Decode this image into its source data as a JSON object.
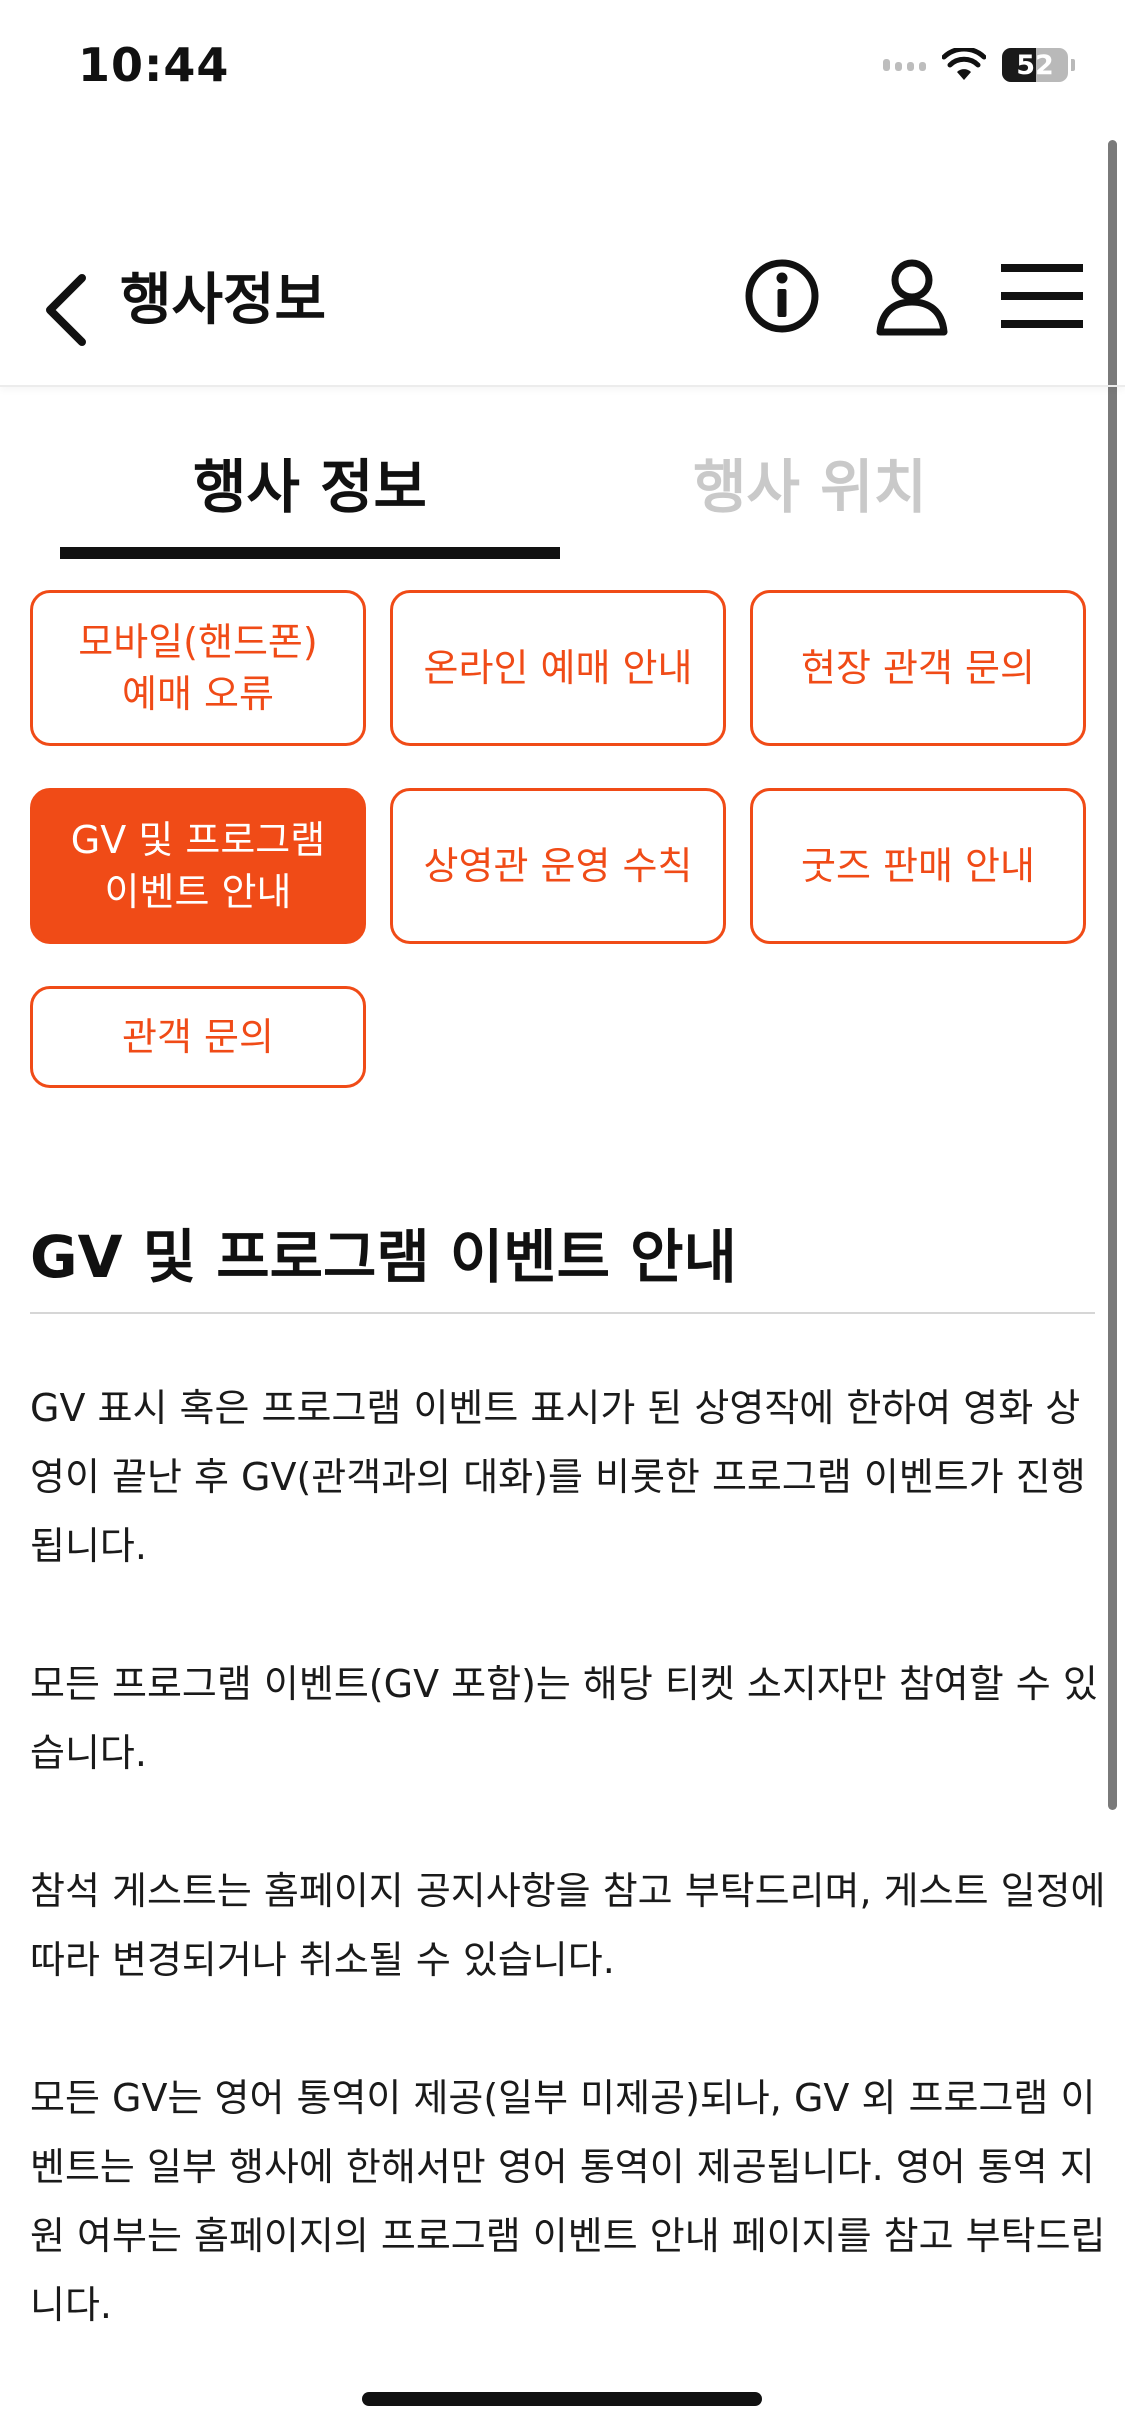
{
  "status_bar": {
    "time": "10:44",
    "battery": "52"
  },
  "header": {
    "title": "행사정보"
  },
  "tabs": [
    {
      "label": "행사 정보",
      "active": true
    },
    {
      "label": "행사 위치",
      "active": false
    }
  ],
  "categories": [
    {
      "label": "모바일(핸드폰)\n예매 오류",
      "active": false
    },
    {
      "label": "온라인 예매 안내",
      "active": false
    },
    {
      "label": "현장 관객 문의",
      "active": false
    },
    {
      "label": "GV 및 프로그램\n이벤트 안내",
      "active": true
    },
    {
      "label": "상영관 운영 수칙",
      "active": false
    },
    {
      "label": "굿즈 판매 안내",
      "active": false
    },
    {
      "label": "관객 문의",
      "active": false
    }
  ],
  "section": {
    "title": "GV 및 프로그램 이벤트 안내",
    "paragraphs": [
      "GV 표시 혹은 프로그램 이벤트 표시가 된 상영작에 한하여 영화 상영이 끝난 후 GV(관객과의 대화)를 비롯한 프로그램 이벤트가 진행됩니다.",
      "모든 프로그램 이벤트(GV 포함)는 해당 티켓 소지자만 참여할 수 있습니다.",
      "참석 게스트는 홈페이지 공지사항을 참고 부탁드리며, 게스트 일정에 따라 변경되거나 취소될 수 있습니다.",
      "모든 GV는 영어 통역이 제공(일부 미제공)되나, GV 외 프로그램 이벤트는 일부 행사에 한해서만 영어 통역이 제공됩니다. 영어 통역 지원 여부는 홈페이지의 프로그램 이벤트 안내 페이지를 참고 부탁드립니다."
    ]
  },
  "colors": {
    "accent": "#f04b17",
    "text": "#111111",
    "inactive_tab": "#c9c9c9"
  },
  "icons": [
    "chevron-left-icon",
    "info-icon",
    "user-icon",
    "menu-icon",
    "wifi-icon",
    "cellular-icon",
    "battery-icon"
  ]
}
